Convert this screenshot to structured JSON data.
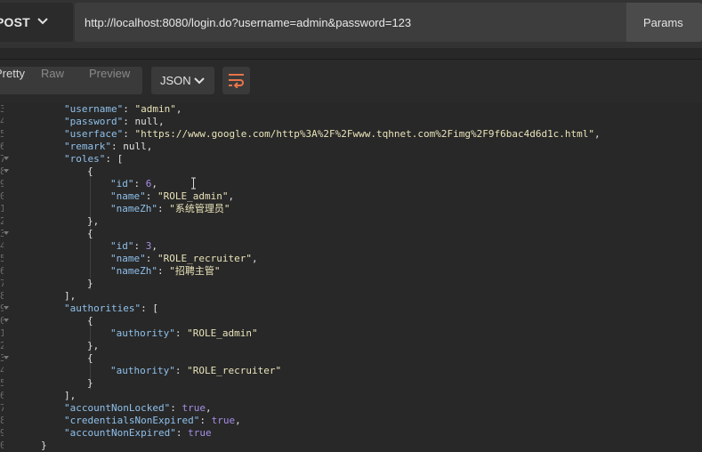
{
  "request": {
    "method": "POST",
    "url": "http://localhost:8080/login.do?username=admin&password=123",
    "params_label": "Params"
  },
  "response_toolbar": {
    "pretty_label": "Pretty",
    "raw_label": "Raw",
    "preview_label": "Preview",
    "format_label": "JSON",
    "wrap_icon": "wrap-lines-icon"
  },
  "code_lines": {
    "l1": {
      "k": "\"username\"",
      "v": "\"admin\""
    },
    "l2": {
      "k": "\"password\"",
      "v": "null"
    },
    "l3": {
      "k": "\"userface\"",
      "v": "\"https://www.google.com/http%3A%2F%2Fwww.tqhnet.com%2Fimg%2F9f6bac4d6d1c.html\""
    },
    "l4": {
      "k": "\"remark\"",
      "v": "null"
    },
    "l5": {
      "k": "\"roles\""
    },
    "l7": {
      "k": "\"id\"",
      "v": "6"
    },
    "l8": {
      "k": "\"name\"",
      "v": "\"ROLE_admin\""
    },
    "l9": {
      "k": "\"nameZh\"",
      "v": "\"系统管理员\""
    },
    "l12": {
      "k": "\"id\"",
      "v": "3"
    },
    "l13": {
      "k": "\"name\"",
      "v": "\"ROLE_recruiter\""
    },
    "l14": {
      "k": "\"nameZh\"",
      "v": "\"招聘主管\""
    },
    "l17": {
      "k": "\"authorities\""
    },
    "l19": {
      "k": "\"authority\"",
      "v": "\"ROLE_admin\""
    },
    "l22": {
      "k": "\"authority\"",
      "v": "\"ROLE_recruiter\""
    },
    "l25": {
      "k": "\"accountNonLocked\"",
      "v": "true"
    },
    "l26": {
      "k": "\"credentialsNonExpired\"",
      "v": "true"
    },
    "l27": {
      "k": "\"accountNonExpired\"",
      "v": "true"
    }
  },
  "line_numbers": [
    "3",
    "4",
    "5",
    "6",
    "7",
    "8",
    "9",
    "0",
    "1",
    "2",
    "3",
    "4",
    "5",
    "6",
    "7",
    "8",
    "9",
    "0",
    "1",
    "2",
    "3",
    "4",
    "5",
    "6",
    "7",
    "8",
    "9",
    "0"
  ],
  "colors": {
    "key": "#8fc0eb",
    "string": "#e9e3b9",
    "number": "#a78ee6",
    "accent": "#e8744a"
  }
}
